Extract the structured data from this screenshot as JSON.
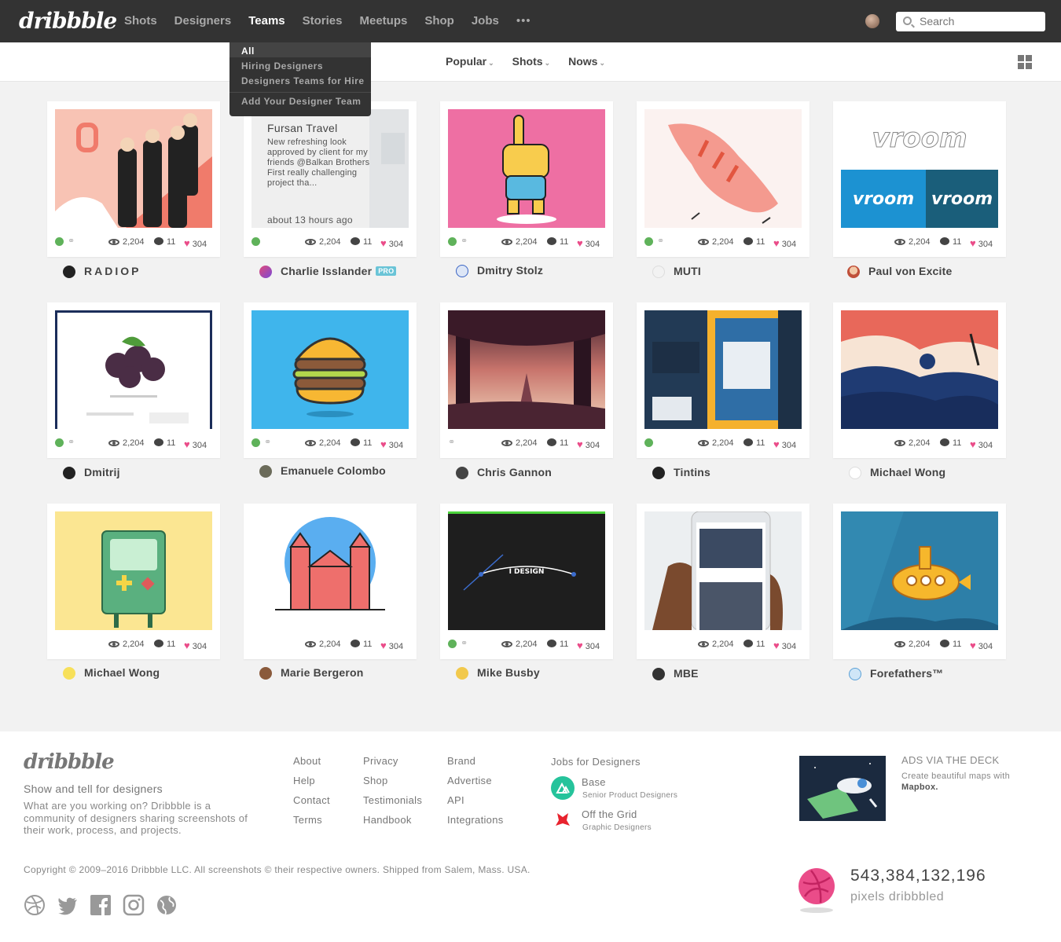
{
  "header": {
    "logo": "dribbble",
    "nav": [
      "Shots",
      "Designers",
      "Teams",
      "Stories",
      "Meetups",
      "Shop",
      "Jobs"
    ],
    "active_nav": "Teams",
    "more": "•••",
    "search_placeholder": "Search"
  },
  "teams_menu": {
    "items": [
      "All",
      "Hiring Designers",
      "Designers Teams for Hire",
      "Add Your Designer Team"
    ]
  },
  "filters": [
    "Popular",
    "Shots",
    "Nows"
  ],
  "shots": [
    {
      "author": "RADIOP",
      "views": "2,204",
      "comments": "11",
      "likes": "304"
    },
    {
      "author": "Charlie Isslander",
      "badge": "PRO",
      "views": "2,204",
      "comments": "11",
      "likes": "304",
      "overlay": {
        "title": "Fursan Travel",
        "description": "New refreshing look approved by client for my friends @Balkan Brothers First really challenging project tha...",
        "time": "about 13 hours ago"
      }
    },
    {
      "author": "Dmitry Stolz",
      "views": "2,204",
      "comments": "11",
      "likes": "304"
    },
    {
      "author": "MUTI",
      "views": "2,204",
      "comments": "11",
      "likes": "304"
    },
    {
      "author": "Paul von Excite",
      "views": "2,204",
      "comments": "11",
      "likes": "304"
    },
    {
      "author": "Dmitrij",
      "views": "2,204",
      "comments": "11",
      "likes": "304"
    },
    {
      "author": "Emanuele Colombo",
      "views": "2,204",
      "comments": "11",
      "likes": "304"
    },
    {
      "author": "Chris Gannon",
      "views": "2,204",
      "comments": "11",
      "likes": "304"
    },
    {
      "author": "Tintins",
      "views": "2,204",
      "comments": "11",
      "likes": "304"
    },
    {
      "author": "Michael Wong",
      "views": "2,204",
      "comments": "11",
      "likes": "304"
    },
    {
      "author": "Michael Wong",
      "views": "2,204",
      "comments": "11",
      "likes": "304"
    },
    {
      "author": "Marie Bergeron",
      "views": "2,204",
      "comments": "11",
      "likes": "304"
    },
    {
      "author": "Mike Busby",
      "views": "2,204",
      "comments": "11",
      "likes": "304"
    },
    {
      "author": "MBE",
      "views": "2,204",
      "comments": "11",
      "likes": "304"
    },
    {
      "author": "Forefathers™",
      "views": "2,204",
      "comments": "11",
      "likes": "304"
    }
  ],
  "shot_art_text": {
    "vroom": "vroom",
    "idesign": "I DESIGN"
  },
  "footer": {
    "logo": "dribbble",
    "tagline": "Show and tell for designers",
    "description": "What are you working on? Dribbble is a community of designers sharing screenshots of their work, process, and projects.",
    "col1": [
      "About",
      "Help",
      "Contact",
      "Terms"
    ],
    "col2": [
      "Privacy",
      "Shop",
      "Testimonials",
      "Handbook"
    ],
    "col3": [
      "Brand",
      "Advertise",
      "API",
      "Integrations"
    ],
    "jobs_title": "Jobs for Designers",
    "jobs": [
      {
        "company": "Base",
        "role": "Senior Product Designers"
      },
      {
        "company": "Off the Grid",
        "role": "Graphic Designers"
      }
    ],
    "ad_title": "ADS VIA THE DECK",
    "ad_text": "Create beautiful maps with",
    "ad_brand": "Mapbox.",
    "copyright": "Copyright © 2009–2016 Dribbble LLC. All screenshots © their respective owners. Shipped from Salem, Mass. USA.",
    "socials": [
      "dribbble-icon",
      "twitter-icon",
      "facebook-icon",
      "instagram-icon",
      "globe-icon"
    ],
    "pixel_count": "543,384,132,196",
    "pixel_label": "pixels dribbbled"
  },
  "colors": {
    "topbar": "#333333",
    "accent_pink": "#ea4c89",
    "pro_badge": "#6ac4d7"
  }
}
